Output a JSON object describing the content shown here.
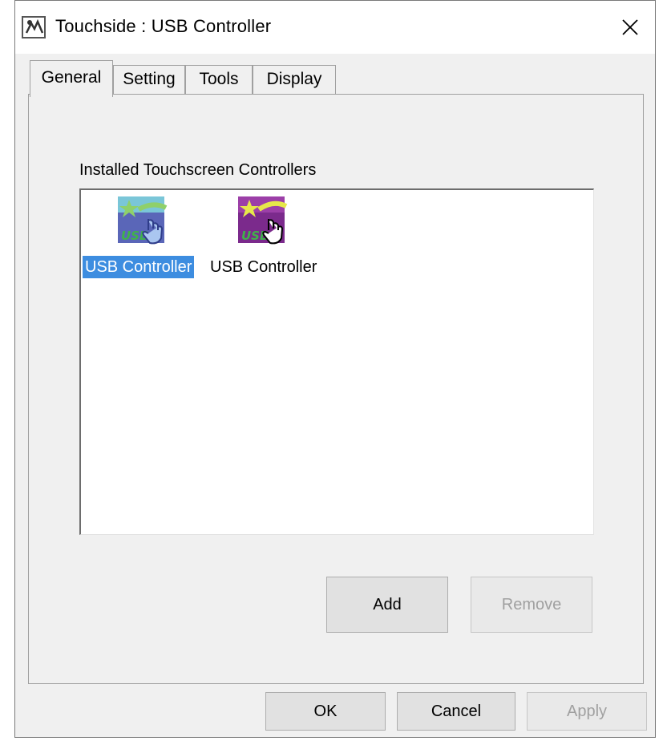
{
  "window": {
    "title": "Touchside : USB Controller"
  },
  "tabs": [
    {
      "label": "General"
    },
    {
      "label": "Setting"
    },
    {
      "label": "Tools"
    },
    {
      "label": "Display"
    }
  ],
  "general": {
    "list_label": "Installed Touchscreen Controllers",
    "controllers": [
      {
        "label": "USB Controller",
        "selected": true,
        "icon": "usb-touch-controller-icon"
      },
      {
        "label": "USB Controller",
        "selected": false,
        "icon": "usb-touch-controller-icon"
      }
    ],
    "add_label": "Add",
    "remove_label": "Remove"
  },
  "footer": {
    "ok_label": "OK",
    "cancel_label": "Cancel",
    "apply_label": "Apply"
  },
  "colors": {
    "selection": "#3d8de0",
    "dialog_bg": "#f0f0f0"
  }
}
